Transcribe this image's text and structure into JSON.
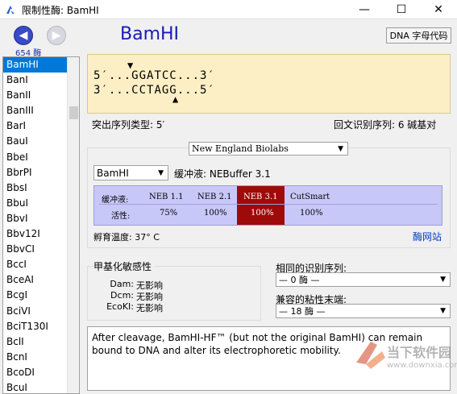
{
  "window": {
    "title": "限制性酶: BamHI",
    "minimize": "—",
    "maximize": "☐",
    "close": "✕"
  },
  "nav": {
    "count": "654 酶"
  },
  "enzymes": [
    "BamHI",
    "BanI",
    "BanII",
    "BanIII",
    "BarI",
    "BauI",
    "BbeI",
    "BbrPI",
    "BbsI",
    "BbuI",
    "BbvI",
    "Bbv12I",
    "BbvCI",
    "BccI",
    "BceAI",
    "BcgI",
    "BciVI",
    "BciT130I",
    "BclI",
    "BcnI",
    "BcoDI",
    "BcuI"
  ],
  "selected_enzyme": "BamHI",
  "header": {
    "enzyme_name": "BamHI",
    "dna_button": "DNA 字母代码"
  },
  "sequence": {
    "top_prefix": "5′...",
    "top_seq": "GGATCC",
    "top_suffix": "...3′",
    "bottom_prefix": "3′...",
    "bottom_seq": "CCTAGG",
    "bottom_suffix": "...5′",
    "top_cut_marker": "▼",
    "bottom_cut_marker": "▲"
  },
  "info": {
    "overhang": "突出序列类型:   5′",
    "palindrome": "回文识别序列:   6 碱基对"
  },
  "supplier": {
    "selected": "New England Biolabs",
    "enzyme_selected": "BamHI",
    "buffer_label": "缓冲液:   NEBuffer 3.1"
  },
  "buffer_table": {
    "row1_label": "缓冲液:",
    "row2_label": "活性:",
    "columns": [
      {
        "name": "NEB 1.1",
        "activity": "75%"
      },
      {
        "name": "NEB 2.1",
        "activity": "100%"
      },
      {
        "name": "NEB 3.1",
        "activity": "100%"
      },
      {
        "name": "CutSmart",
        "activity": "100%"
      }
    ],
    "highlight_color": "#9e0a0a"
  },
  "incubation": "孵育温度:   37° C",
  "website_link": "酶网站",
  "methylation": {
    "title": "甲基化敏感性",
    "rows": [
      {
        "name": "Dam:",
        "value": "无影响"
      },
      {
        "name": "Dcm:",
        "value": "无影响"
      },
      {
        "name": "EcoKI:",
        "value": "无影响"
      }
    ]
  },
  "same_recognition": {
    "label": "相同的识别序列:",
    "value": "— 0 酶 —"
  },
  "compatible_ends": {
    "label": "兼容的粘性末端:",
    "value": "— 18 酶 —"
  },
  "note": "After cleavage, BamHI-HF™ (but not the original BamHI) can remain bound to DNA and alter its electrophoretic mobility.",
  "watermark": {
    "title": "当下软件园",
    "url": "www.downxia.com"
  }
}
